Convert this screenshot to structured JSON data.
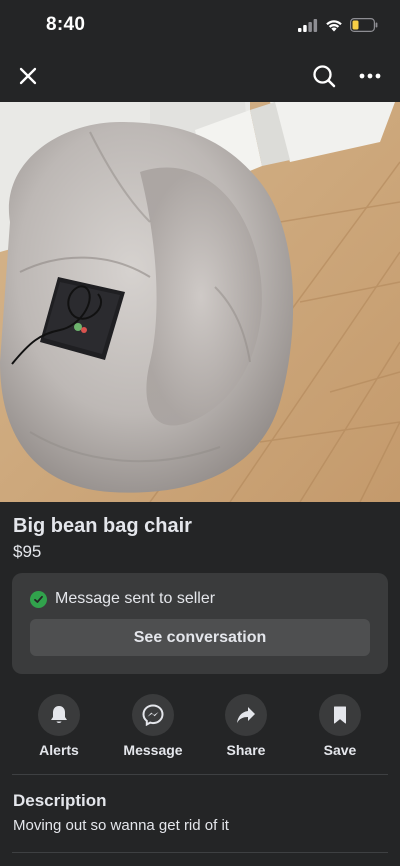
{
  "status_bar": {
    "time": "8:40",
    "icons": [
      "signal-icon",
      "wifi-icon",
      "battery-icon"
    ]
  },
  "topbar": {
    "icons": [
      "close-icon",
      "search-icon",
      "more-icon"
    ]
  },
  "listing": {
    "title": "Big bean bag chair",
    "price": "$95"
  },
  "message_card": {
    "status": "Message sent to seller",
    "button_label": "See conversation"
  },
  "actions": [
    {
      "label": "Alerts",
      "icon": "bell-icon"
    },
    {
      "label": "Message",
      "icon": "messenger-icon"
    },
    {
      "label": "Share",
      "icon": "share-icon"
    },
    {
      "label": "Save",
      "icon": "bookmark-icon"
    }
  ],
  "description": {
    "heading": "Description",
    "text": "Moving out so wanna get rid of it"
  },
  "colors": {
    "background": "#242526",
    "card": "#3a3b3c",
    "success": "#31a24c",
    "text": "#e4e6eb"
  }
}
